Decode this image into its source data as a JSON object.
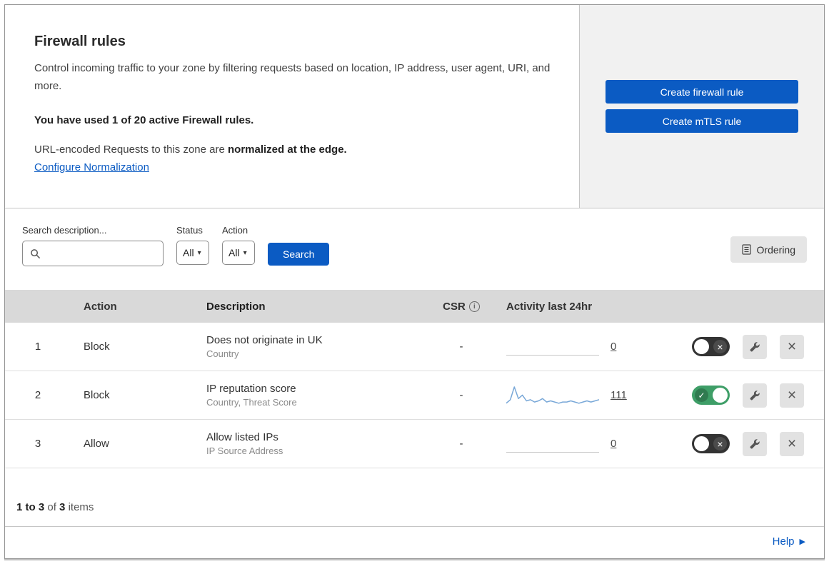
{
  "colors": {
    "accent_blue": "#0b5bc3",
    "toggle_on": "#3e9e67",
    "toggle_off": "#333333",
    "spark_blue": "#79a8d8"
  },
  "header": {
    "title": "Firewall rules",
    "description": "Control incoming traffic to your zone by filtering requests based on location, IP address, user agent, URI, and more.",
    "usage_note": "You have used 1 of 20 active Firewall rules.",
    "normalization_text": "URL-encoded Requests to this zone are",
    "normalization_bold": "normalized at the edge.",
    "normalization_link": "Configure Normalization",
    "create_firewall_button": "Create firewall rule",
    "create_mtls_button": "Create mTLS rule"
  },
  "filters": {
    "search_label": "Search description...",
    "status_label": "Status",
    "status_value": "All",
    "action_label": "Action",
    "action_value": "All",
    "search_button": "Search",
    "ordering_button": "Ordering"
  },
  "table": {
    "headers": {
      "action": "Action",
      "description": "Description",
      "csr": "CSR",
      "activity": "Activity last 24hr"
    },
    "rows": [
      {
        "num": "1",
        "action": "Block",
        "description": "Does not originate in UK",
        "criteria": "Country",
        "csr": "-",
        "activity_count": "0",
        "enabled": false,
        "sparkline": []
      },
      {
        "num": "2",
        "action": "Block",
        "description": "IP reputation score",
        "criteria": "Country, Threat Score",
        "csr": "-",
        "activity_count": "111",
        "enabled": true,
        "sparkline": [
          2,
          5,
          16,
          6,
          9,
          4,
          5,
          3,
          4,
          6,
          3,
          4,
          3,
          2,
          3,
          3,
          4,
          3,
          2,
          3,
          4,
          3,
          4,
          5
        ]
      },
      {
        "num": "3",
        "action": "Allow",
        "description": "Allow listed IPs",
        "criteria": "IP Source Address",
        "csr": "-",
        "activity_count": "0",
        "enabled": false,
        "sparkline": []
      }
    ],
    "footer": {
      "range": "1 to 3",
      "of": "of",
      "total": "3",
      "items": "items"
    }
  },
  "help": {
    "label": "Help"
  },
  "icons": {
    "caret_down": "▾",
    "caret_right": "▶",
    "check": "✓",
    "cross": "×",
    "close": "×",
    "info": "i"
  }
}
